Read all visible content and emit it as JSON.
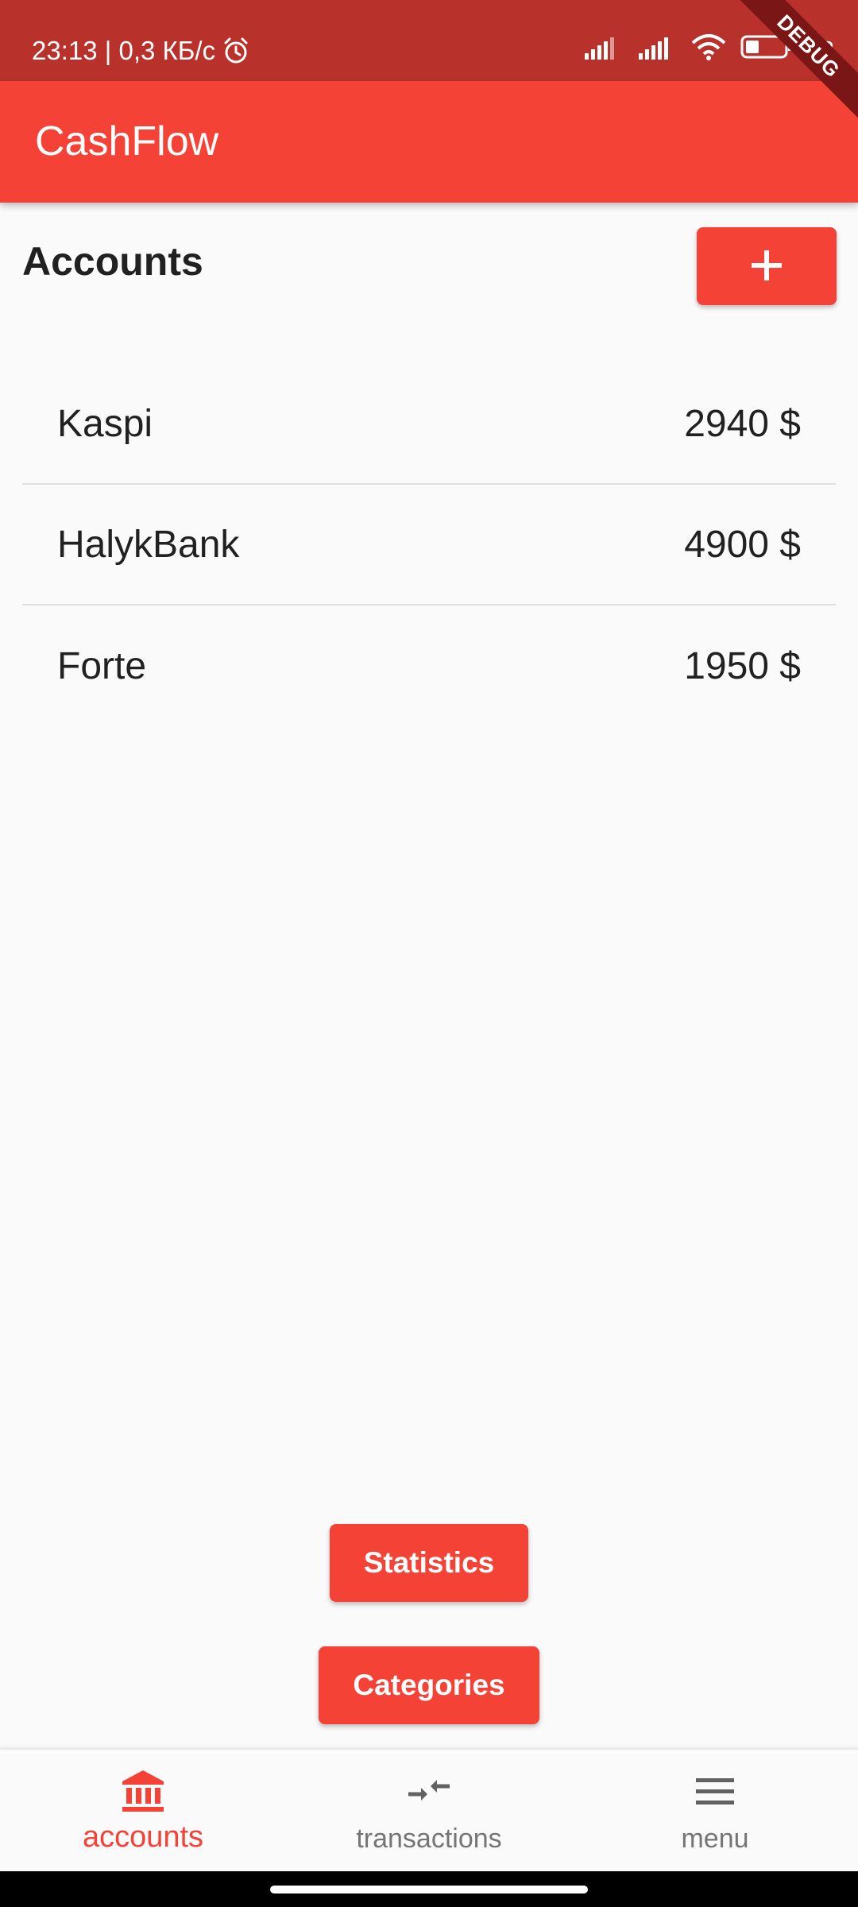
{
  "status_bar": {
    "time_speed": "23:13 | 0,3 КБ/с",
    "battery_percent": "32"
  },
  "debug_banner": "DEBUG",
  "app_bar": {
    "title": "CashFlow"
  },
  "accounts_section": {
    "title": "Accounts",
    "add_icon": "plus-icon"
  },
  "accounts": [
    {
      "name": "Kaspi",
      "amount": "2940 $"
    },
    {
      "name": "HalykBank",
      "amount": "4900 $"
    },
    {
      "name": "Forte",
      "amount": "1950 $"
    }
  ],
  "actions": {
    "statistics_label": "Statistics",
    "categories_label": "Categories"
  },
  "bottom_nav": {
    "items": [
      {
        "label": "accounts",
        "icon": "bank-icon",
        "active": true
      },
      {
        "label": "transactions",
        "icon": "transfer-arrows-icon",
        "active": false
      },
      {
        "label": "menu",
        "icon": "menu-icon",
        "active": false
      }
    ]
  },
  "colors": {
    "primary": "#f44336",
    "status_bar": "#b8322b",
    "background": "#fafafa",
    "inactive": "#757575"
  }
}
